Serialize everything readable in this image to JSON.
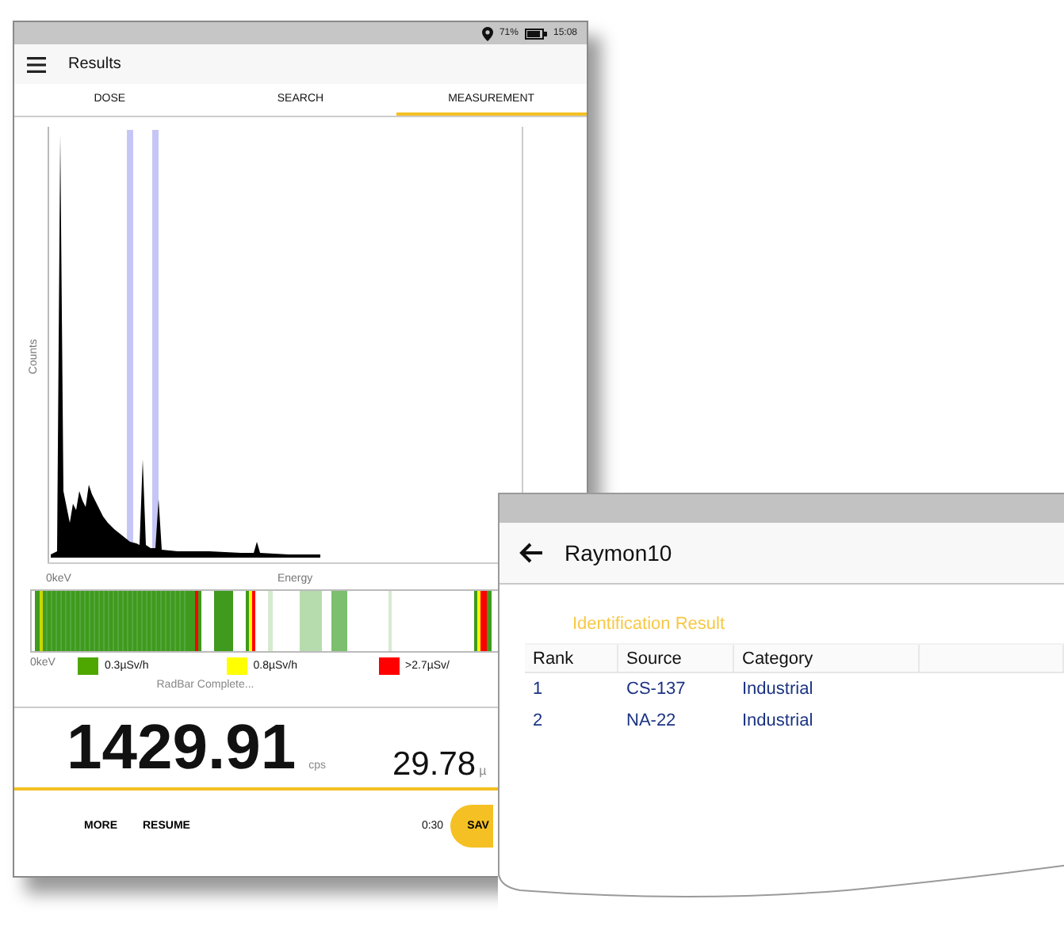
{
  "tablet": {
    "status_bar": {
      "battery": "71%",
      "time": "15:08"
    },
    "app_bar": {
      "title": "Results"
    },
    "tabs": [
      {
        "label": "DOSE",
        "selected": false
      },
      {
        "label": "SEARCH",
        "selected": false
      },
      {
        "label": "MEASUREMENT",
        "selected": true
      }
    ],
    "spectrum": {
      "y_axis_label": "Counts",
      "x_start_label": "0keV",
      "x_axis_label": "Energy"
    },
    "radbar": {
      "start_label": "0keV",
      "legend": [
        {
          "label": "0.3µSv/h",
          "color": "#4ea600"
        },
        {
          "label": "0.8µSv/h",
          "color": "#ffff00"
        },
        {
          "label": ">2.7µSv/",
          "color": "#ff0000"
        }
      ],
      "status": "RadBar Complete..."
    },
    "readings": [
      {
        "kind": "primary",
        "value": "1429.91",
        "unit": "cps"
      },
      {
        "kind": "secondary",
        "value": "29.78",
        "unit": "µ"
      }
    ],
    "bottom_bar": {
      "buttons": [
        "MORE",
        "RESUME"
      ],
      "timer": "0:30",
      "save_button": "SAV"
    }
  },
  "detail_window": {
    "title": "Raymon10",
    "section_title": "Identification Result",
    "table": {
      "columns": [
        "Rank",
        "Source",
        "Category"
      ],
      "rows": [
        [
          "1",
          "CS-137",
          "Industrial"
        ],
        [
          "2",
          "NA-22",
          "Industrial"
        ]
      ]
    }
  }
}
